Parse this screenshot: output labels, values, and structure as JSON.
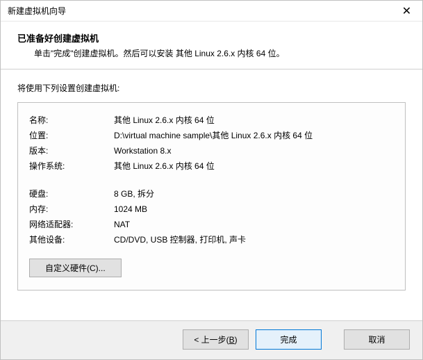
{
  "window": {
    "title": "新建虚拟机向导"
  },
  "header": {
    "title": "已准备好创建虚拟机",
    "subtitle": "单击\"完成\"创建虚拟机。然后可以安装 其他 Linux 2.6.x 内核 64 位。"
  },
  "body": {
    "label": "将使用下列设置创建虚拟机:"
  },
  "specs": {
    "group1": [
      {
        "label": "名称:",
        "value": "其他 Linux 2.6.x 内核 64 位"
      },
      {
        "label": "位置:",
        "value": "D:\\virtual machine sample\\其他 Linux 2.6.x 内核 64 位"
      },
      {
        "label": "版本:",
        "value": "Workstation 8.x"
      },
      {
        "label": "操作系统:",
        "value": "其他 Linux 2.6.x 内核 64 位"
      }
    ],
    "group2": [
      {
        "label": "硬盘:",
        "value": "8 GB, 拆分"
      },
      {
        "label": "内存:",
        "value": "1024 MB"
      },
      {
        "label": "网络适配器:",
        "value": "NAT"
      },
      {
        "label": "其他设备:",
        "value": "CD/DVD, USB 控制器, 打印机, 声卡"
      }
    ]
  },
  "buttons": {
    "customize": "自定义硬件(C)...",
    "back_prefix": "< 上一步(",
    "back_key": "B",
    "back_suffix": ")",
    "finish": "完成",
    "cancel": "取消"
  }
}
